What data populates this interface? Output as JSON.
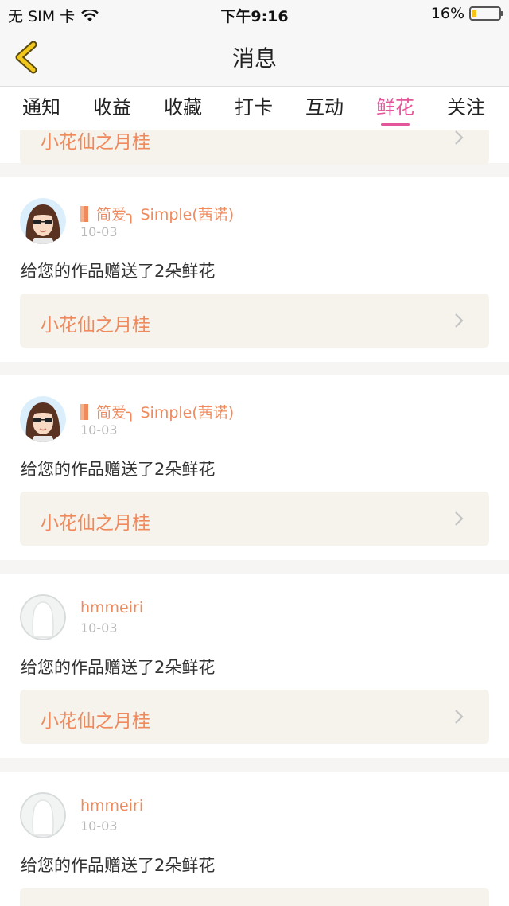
{
  "status_bar": {
    "carrier": "无 SIM 卡",
    "time": "下午9:16",
    "battery_percent_text": "16%",
    "battery_level": 0.16,
    "wifi_icon": "wifi-icon"
  },
  "nav": {
    "title": "消息",
    "back_icon": "chevron-left-icon"
  },
  "tabs": [
    {
      "label": "通知"
    },
    {
      "label": "收益"
    },
    {
      "label": "收藏"
    },
    {
      "label": "打卡"
    },
    {
      "label": "互动"
    },
    {
      "label": "鲜花",
      "active": true
    },
    {
      "label": "关注"
    }
  ],
  "partial_card": {
    "link_title": "小花仙之月桂"
  },
  "cards": [
    {
      "username": "简爱╮ Simple(茜诺)",
      "date": "10-03",
      "message": "给您的作品赠送了2朵鲜花",
      "link_title": "小花仙之月桂"
    },
    {
      "username": "简爱╮ Simple(茜诺)",
      "date": "10-03",
      "message": "给您的作品赠送了2朵鲜花",
      "link_title": "小花仙之月桂"
    },
    {
      "username": "hmmeiri",
      "date": "10-03",
      "message": "给您的作品赠送了2朵鲜花",
      "link_title": "小花仙之月桂"
    },
    {
      "username": "hmmeiri",
      "date": "10-03",
      "message": "给您的作品赠送了2朵鲜花",
      "link_title": ""
    }
  ],
  "colors": {
    "accent_pink": "#e4569a",
    "username_orange": "#f08a5d",
    "link_box_bg": "#f5f3ec"
  }
}
